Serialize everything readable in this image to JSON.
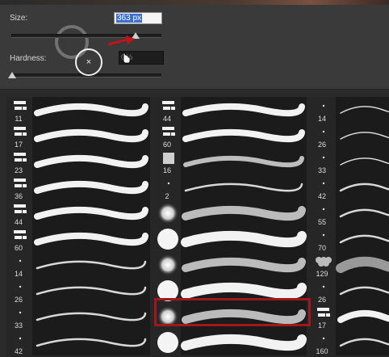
{
  "panel": {
    "size_label": "Size:",
    "size_value": "363 px",
    "hardness_label": "Hardness:",
    "hardness_value": "0%",
    "size_slider_percent": 83,
    "hardness_slider_percent": 1
  },
  "cursor": {
    "symbol": "×",
    "hand_icon": "hand-cursor-icon"
  },
  "colors": {
    "panel_bg": "#3a3a3a",
    "grid_bg": "#262626",
    "selection": "#a0181c",
    "arrow": "#c0141a",
    "input_highlight": "#3c6fd0"
  },
  "columns": [
    {
      "items": [
        {
          "num": "11",
          "kind": "scatter"
        },
        {
          "num": "17",
          "kind": "scatter"
        },
        {
          "num": "23",
          "kind": "scatter"
        },
        {
          "num": "36",
          "kind": "scatter"
        },
        {
          "num": "44",
          "kind": "scatter"
        },
        {
          "num": "60",
          "kind": "scatter"
        },
        {
          "num": "14",
          "kind": "dot"
        },
        {
          "num": "26",
          "kind": "dot"
        },
        {
          "num": "33",
          "kind": "dot"
        },
        {
          "num": "42",
          "kind": "dot"
        }
      ]
    },
    {
      "items": [
        {
          "num": "44",
          "kind": "scatter"
        },
        {
          "num": "60",
          "kind": "scatter"
        },
        {
          "num": "16",
          "kind": "square"
        },
        {
          "num": "2",
          "kind": "dot"
        },
        {
          "num": "",
          "kind": "soft"
        },
        {
          "num": "",
          "kind": "hard"
        },
        {
          "num": "",
          "kind": "soft"
        },
        {
          "num": "",
          "kind": "hard"
        },
        {
          "num": "",
          "kind": "soft"
        },
        {
          "num": "",
          "kind": "hard"
        }
      ]
    },
    {
      "items": [
        {
          "num": "14",
          "kind": "dot"
        },
        {
          "num": "26",
          "kind": "dot"
        },
        {
          "num": "33",
          "kind": "dot"
        },
        {
          "num": "42",
          "kind": "dot"
        },
        {
          "num": "55",
          "kind": "dot"
        },
        {
          "num": "70",
          "kind": "dot"
        },
        {
          "num": "129",
          "kind": "cloud"
        },
        {
          "num": "26",
          "kind": "dot"
        },
        {
          "num": "17",
          "kind": "scatter"
        },
        {
          "num": "160",
          "kind": "dot"
        }
      ]
    }
  ]
}
